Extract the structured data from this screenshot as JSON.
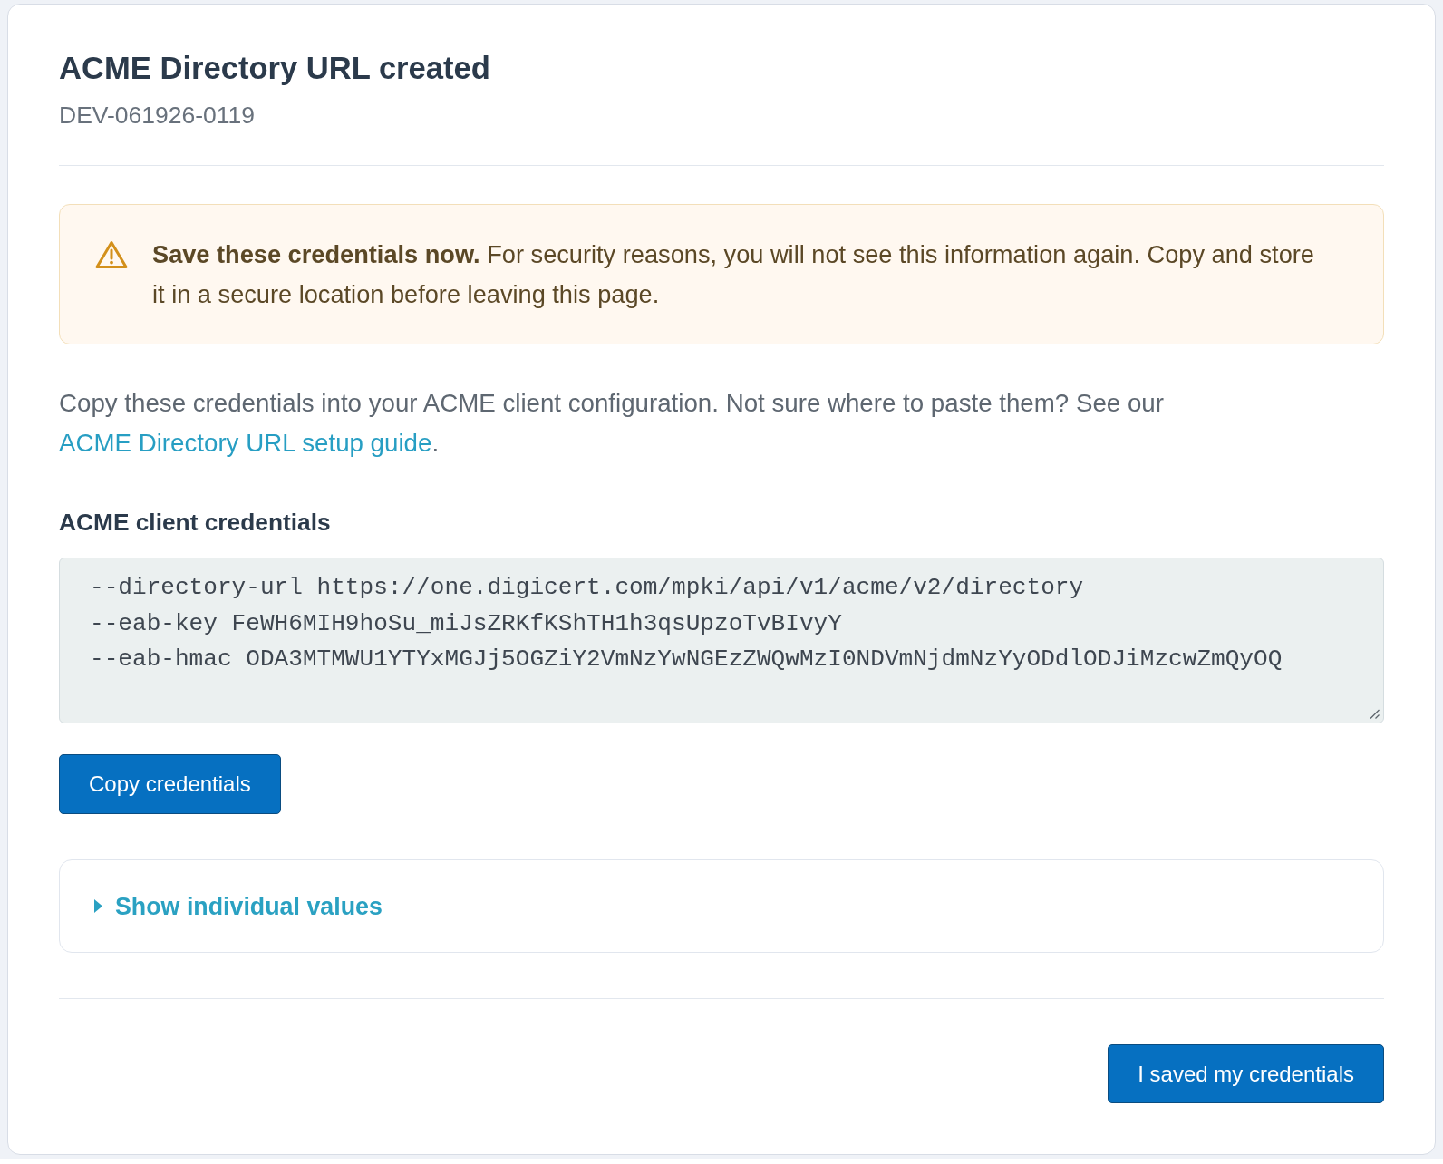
{
  "header": {
    "title": "ACME Directory URL created",
    "subtitle": "DEV-061926-0119"
  },
  "alert": {
    "kind": "warning",
    "message": "**Save these credentials now.** For security reasons, you will not see this information again. Copy and store it in a secure location before leaving this page."
  },
  "intro": {
    "text": "Copy these credentials into your ACME client configuration. Not sure where to paste them? See our",
    "link": "ACME Directory URL setup guide",
    "suffix": "."
  },
  "credentials": {
    "label": "ACME client credentials",
    "lines": [
      "--directory-url https://one.digicert.com/mpki/api/v1/acme/v2/directory",
      "--eab-key FeWH6MIH9hoSu_miJsZRKfKShTH1h3qsUpzoTvBIvyY",
      "--eab-hmac ODA3MTMWU1YTYxMGJj5OGZiY2VmNzYwNGEzZWQwMzI0NDVmNjdmNzYyODdlODJiMzcwZmQyOQ"
    ],
    "copy_button": "Copy credentials"
  },
  "disclosure": {
    "label": "Show individual values",
    "expanded": false
  },
  "footer": {
    "button": "I saved my credentials"
  }
}
